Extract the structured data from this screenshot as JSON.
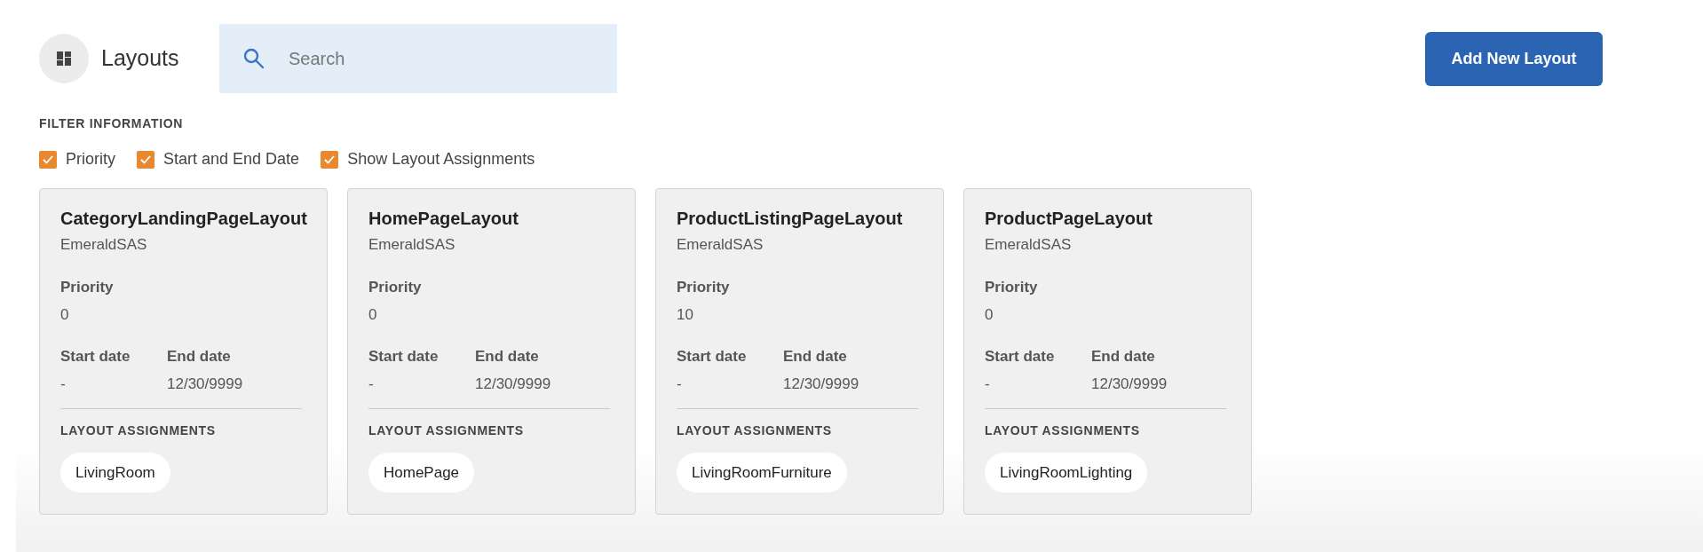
{
  "header": {
    "title": "Layouts",
    "search": {
      "placeholder": "Search"
    },
    "add_button": "Add New Layout"
  },
  "filter": {
    "heading": "FILTER INFORMATION",
    "options": [
      {
        "label": "Priority",
        "checked": true
      },
      {
        "label": "Start and End Date",
        "checked": true
      },
      {
        "label": "Show Layout Assignments",
        "checked": true
      }
    ]
  },
  "cards": [
    {
      "title": "CategoryLandingPageLayout",
      "site": "EmeraldSAS",
      "priority_label": "Priority",
      "priority": "0",
      "start_label": "Start date",
      "start": "-",
      "end_label": "End date",
      "end": "12/30/9999",
      "assignments_label": "LAYOUT ASSIGNMENTS",
      "assignments": [
        "LivingRoom"
      ]
    },
    {
      "title": "HomePageLayout",
      "site": "EmeraldSAS",
      "priority_label": "Priority",
      "priority": "0",
      "start_label": "Start date",
      "start": "-",
      "end_label": "End date",
      "end": "12/30/9999",
      "assignments_label": "LAYOUT ASSIGNMENTS",
      "assignments": [
        "HomePage"
      ]
    },
    {
      "title": "ProductListingPageLayout",
      "site": "EmeraldSAS",
      "priority_label": "Priority",
      "priority": "10",
      "start_label": "Start date",
      "start": "-",
      "end_label": "End date",
      "end": "12/30/9999",
      "assignments_label": "LAYOUT ASSIGNMENTS",
      "assignments": [
        "LivingRoomFurniture"
      ]
    },
    {
      "title": "ProductPageLayout",
      "site": "EmeraldSAS",
      "priority_label": "Priority",
      "priority": "0",
      "start_label": "Start date",
      "start": "-",
      "end_label": "End date",
      "end": "12/30/9999",
      "assignments_label": "LAYOUT ASSIGNMENTS",
      "assignments": [
        "LivingRoomLighting"
      ]
    }
  ]
}
